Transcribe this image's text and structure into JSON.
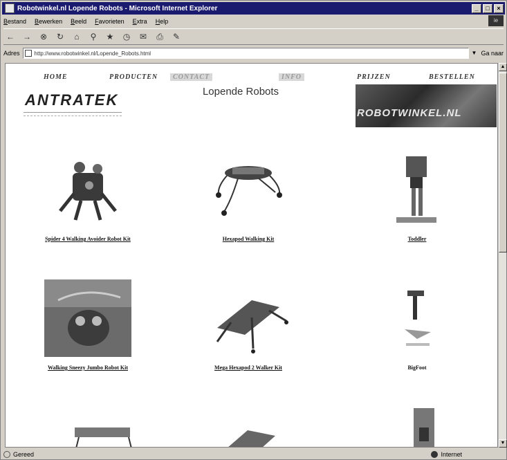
{
  "window": {
    "title": "Robotwinkel.nl Lopende Robots - Microsoft Internet Explorer",
    "controls": {
      "minimize": "_",
      "maximize": "□",
      "close": "×"
    }
  },
  "menu": {
    "items": [
      "Bestand",
      "Bewerken",
      "Beeld",
      "Favorieten",
      "Extra",
      "Help"
    ],
    "logo": "ie"
  },
  "toolbar": {
    "buttons": [
      "back-icon",
      "forward-icon",
      "stop-icon",
      "refresh-icon",
      "home-icon",
      "search-icon",
      "favorites-icon",
      "history-icon",
      "mail-icon",
      "print-icon",
      "edit-icon"
    ]
  },
  "address": {
    "label": "Adres",
    "url": "http://www.robotwinkel.nl/Lopende_Robots.html",
    "go_label": "Ga naar"
  },
  "nav": {
    "home": "HOME",
    "producten": "PRODUCTEN",
    "contact": "CONTACT",
    "info": "INFO",
    "prijzen": "PRIJZEN",
    "bestellen": "BESTELLEN"
  },
  "brand": {
    "logo_text": "ANTRATEK"
  },
  "page": {
    "title": "Lopende Robots"
  },
  "banner": {
    "text": "ROBOTWINKEL.NL"
  },
  "products": [
    {
      "name": "Spider 4 Walking Avoider Robot Kit"
    },
    {
      "name": "Hexapod Walking Kit"
    },
    {
      "name": "Toddler"
    },
    {
      "name": "Walking Sneezy Jumbo Robot Kit"
    },
    {
      "name": "Mega Hexapod 2 Walker Kit"
    },
    {
      "name": "BigFoot"
    }
  ],
  "status": {
    "message": "Gereed",
    "zone": "Internet"
  }
}
